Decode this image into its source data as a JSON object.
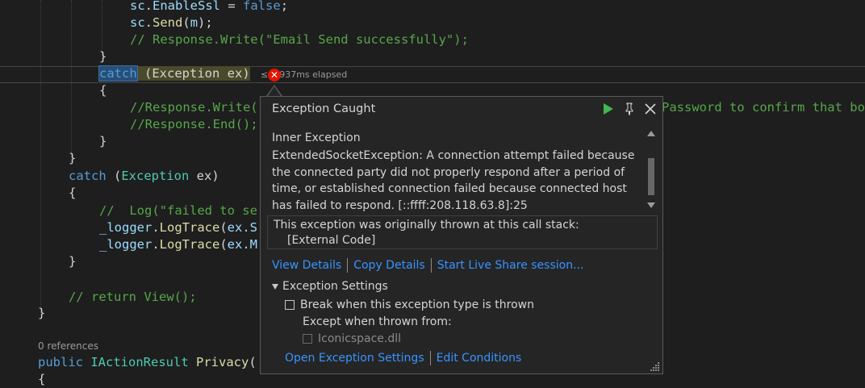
{
  "code": {
    "line_sc_enable": {
      "obj": "sc",
      "dot": ".",
      "prop": "EnableSsl",
      "eq": " = ",
      "val": "false",
      "end": ";"
    },
    "line_sc_send": {
      "obj": "sc",
      "dot": ".",
      "fn": "Send",
      "open": "(",
      "arg": "m",
      "close": ");"
    },
    "line_comment_resp": "// Response.Write(\"Email Send successfully\");",
    "brace_close": "}",
    "brace_open": "{",
    "catch_kw": "catch",
    "catch_rest": " (Exception ex)",
    "elapsed": "≤ 1,937ms elapsed",
    "comment_resp_write": "//Response.Write(",
    "comment_resp_write_tail": "Password to confirm that bo",
    "comment_resp_end": "//Response.End();",
    "catch2_kw": "catch",
    "catch2_paren_open": " (",
    "catch2_type": "Exception",
    "catch2_var": " ex)",
    "comment_log": "//  Log(\"failed to se",
    "logger1": {
      "obj": "_logger",
      "dot": ".",
      "fn": "LogTrace",
      "open": "(",
      "arg": "ex",
      "tail": ".S"
    },
    "logger2": {
      "obj": "_logger",
      "dot": ".",
      "fn": "LogTrace",
      "open": "(",
      "arg": "ex",
      "tail": ".M"
    },
    "comment_return": "// return View();",
    "codelens": "0 references",
    "privacy": {
      "kw": "public",
      "type": " IActionResult",
      "fn": " Privacy",
      "tail": "("
    }
  },
  "popup": {
    "title": "Exception Caught",
    "inner_heading": "Inner Exception",
    "inner_message": "ExtendedSocketException: A connection attempt failed because the connected party did not properly respond after a period of time, or established connection failed because connected host has failed to respond. [::ffff:208.118.63.8]:25",
    "stack_heading": "This exception was originally thrown at this call stack:",
    "stack_item": "[External Code]",
    "link_view": "View Details",
    "link_copy": "Copy Details",
    "link_share": "Start Live Share session...",
    "settings_heading": "Exception Settings",
    "break_label": "Break when this exception type is thrown",
    "except_label": "Except when thrown from:",
    "dll_label": "Iconicspace.dll",
    "link_open_settings": "Open Exception Settings",
    "link_edit_conditions": "Edit Conditions"
  },
  "icons": {
    "continue": "play-icon",
    "pin": "pin-icon",
    "close": "close-icon",
    "error": "error-icon"
  },
  "colors": {
    "accent_link": "#3794ff",
    "error": "#e51400",
    "continue": "#3fb950"
  }
}
